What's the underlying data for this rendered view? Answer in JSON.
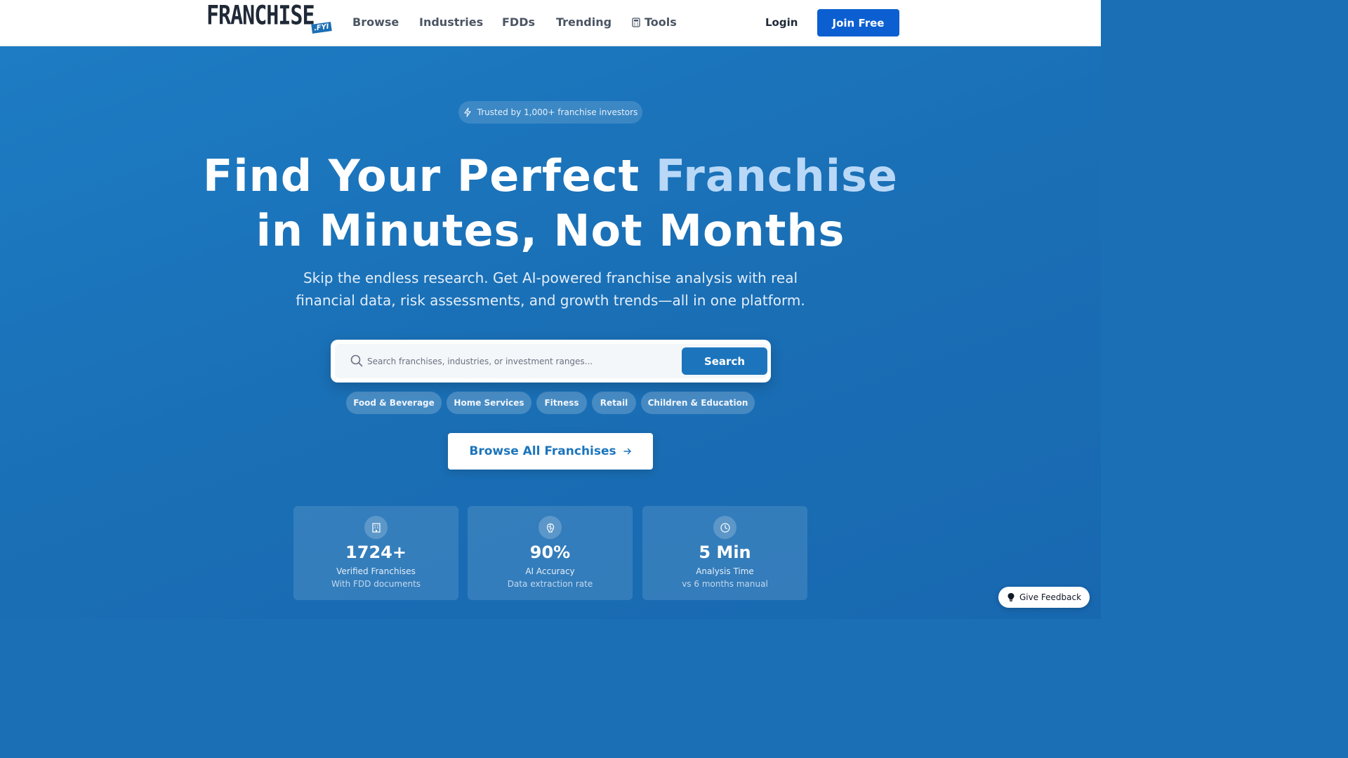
{
  "header": {
    "logo_text": "FRANCHISE",
    "logo_tag": ".FYI",
    "nav": {
      "browse": "Browse",
      "industries": "Industries",
      "fdds": "FDDs",
      "trending": "Trending",
      "tools": "Tools"
    },
    "login": "Login",
    "join": "Join Free"
  },
  "hero": {
    "badge": "Trusted by 1,000+ franchise investors",
    "title_part1": "Find Your Perfect ",
    "title_accent": "Franchise",
    "title_line2": "in Minutes, Not Months",
    "subtitle_line1": "Skip the endless research. Get AI-powered franchise analysis with real",
    "subtitle_line2": "financial data, risk assessments, and growth trends—all in one platform.",
    "search": {
      "placeholder": "Search franchises, industries, or investment ranges...",
      "button": "Search"
    },
    "chips": [
      "Food & Beverage",
      "Home Services",
      "Fitness",
      "Retail",
      "Children & Education"
    ],
    "browse_all": "Browse All Franchises",
    "stats": [
      {
        "value": "1724+",
        "label": "Verified Franchises",
        "sub": "With FDD documents",
        "icon": "building-icon"
      },
      {
        "value": "90%",
        "label": "AI Accuracy",
        "sub": "Data extraction rate",
        "icon": "brain-icon"
      },
      {
        "value": "5 Min",
        "label": "Analysis Time",
        "sub": "vs 6 months manual",
        "icon": "clock-icon"
      }
    ]
  },
  "feedback": "Give Feedback",
  "colors": {
    "brand_blue": "#1c75bc",
    "join_button": "#0b5fd1",
    "accent_light": "#b9d8f7"
  }
}
